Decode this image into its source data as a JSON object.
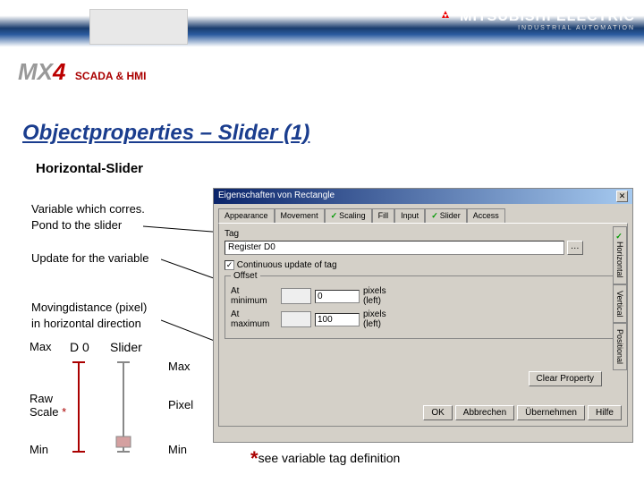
{
  "header": {
    "brand": "MITSUBISHI ELECTRIC",
    "brand_sub": "INDUSTRIAL AUTOMATION",
    "mx4": "MX",
    "mx4_num": "4",
    "mx4_sub": "SCADA & HMI"
  },
  "title": "Objectproperties – Slider (1)",
  "subtitle": "Horizontal-Slider",
  "annotations": {
    "a1_l1": "Variable which corres.",
    "a1_l2": "Pond to the slider",
    "a2": "Update for the variable",
    "a3_l1": "Movingdistance (pixel)",
    "a3_l2": "in horizontal direction"
  },
  "diagram": {
    "d0": "D 0",
    "slider": "Slider",
    "max1": "Max",
    "max2": "Max",
    "raw": "Raw",
    "scale": "Scale",
    "ast": "*",
    "pixel": "Pixel",
    "min1": "Min",
    "min2": "Min"
  },
  "dialog": {
    "title": "Eigenschaften von Rectangle",
    "tabs": [
      "Appearance",
      "Movement",
      "Scaling",
      "Fill",
      "Input",
      "Slider",
      "Access"
    ],
    "checked_tabs": [
      2,
      5
    ],
    "side_tabs": [
      "Horizontal",
      "Vertical",
      "Positional"
    ],
    "side_checked": [
      0
    ],
    "tag_label": "Tag",
    "tag_value": "Register D0",
    "cont_update": "Continuous update of tag",
    "offset_title": "Offset",
    "at_min": "At minimum",
    "at_max": "At maximum",
    "val_min": "0",
    "val_max": "100",
    "unit1": "pixels (left)",
    "unit2": "pixels (left)",
    "clear": "Clear Property",
    "buttons": [
      "OK",
      "Abbrechen",
      "Übernehmen",
      "Hilfe"
    ]
  },
  "footnote": {
    "ast": "*",
    "text": "see variable tag definition"
  }
}
